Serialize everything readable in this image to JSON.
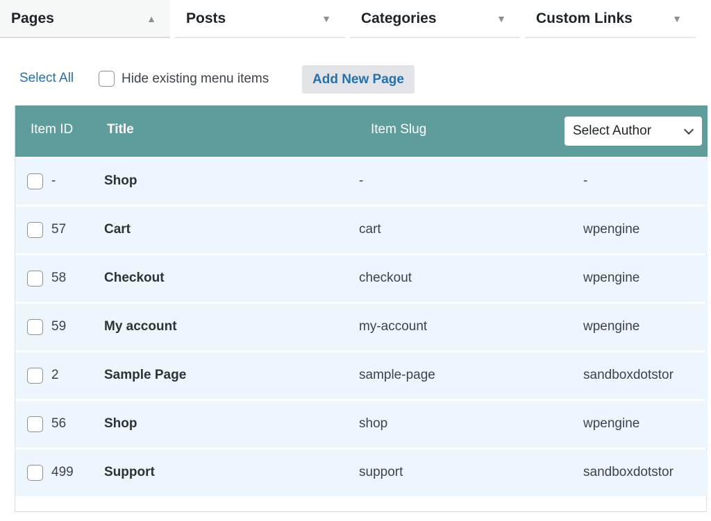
{
  "tabs": [
    {
      "label": "Pages",
      "indicator": "▲",
      "active": true
    },
    {
      "label": "Posts",
      "indicator": "▼",
      "active": false
    },
    {
      "label": "Categories",
      "indicator": "▼",
      "active": false
    },
    {
      "label": "Custom Links",
      "indicator": "▼",
      "active": false
    }
  ],
  "toolbar": {
    "select_all": "Select All",
    "hide_existing": "Hide existing menu items",
    "add_new_page": "Add New Page"
  },
  "table": {
    "headers": {
      "item_id": "Item ID",
      "title": "Title",
      "item_slug": "Item Slug",
      "author_select": "Select Author"
    },
    "rows": [
      {
        "id": "-",
        "title": "Shop",
        "slug": "-",
        "author": "-"
      },
      {
        "id": "57",
        "title": "Cart",
        "slug": "cart",
        "author": "wpengine"
      },
      {
        "id": "58",
        "title": "Checkout",
        "slug": "checkout",
        "author": "wpengine"
      },
      {
        "id": "59",
        "title": "My account",
        "slug": "my-account",
        "author": "wpengine"
      },
      {
        "id": "2",
        "title": "Sample Page",
        "slug": "sample-page",
        "author": "sandboxdotstor"
      },
      {
        "id": "56",
        "title": "Shop",
        "slug": "shop",
        "author": "wpengine"
      },
      {
        "id": "499",
        "title": "Support",
        "slug": "support",
        "author": "sandboxdotstor"
      }
    ]
  },
  "colors": {
    "header_bg": "#5f9c9c",
    "row_bg": "#eef6fd",
    "link": "#2271b1"
  },
  "icons": {
    "tab_open": "triangle-up-icon",
    "tab_closed": "triangle-down-icon",
    "select": "chevron-down-icon"
  }
}
